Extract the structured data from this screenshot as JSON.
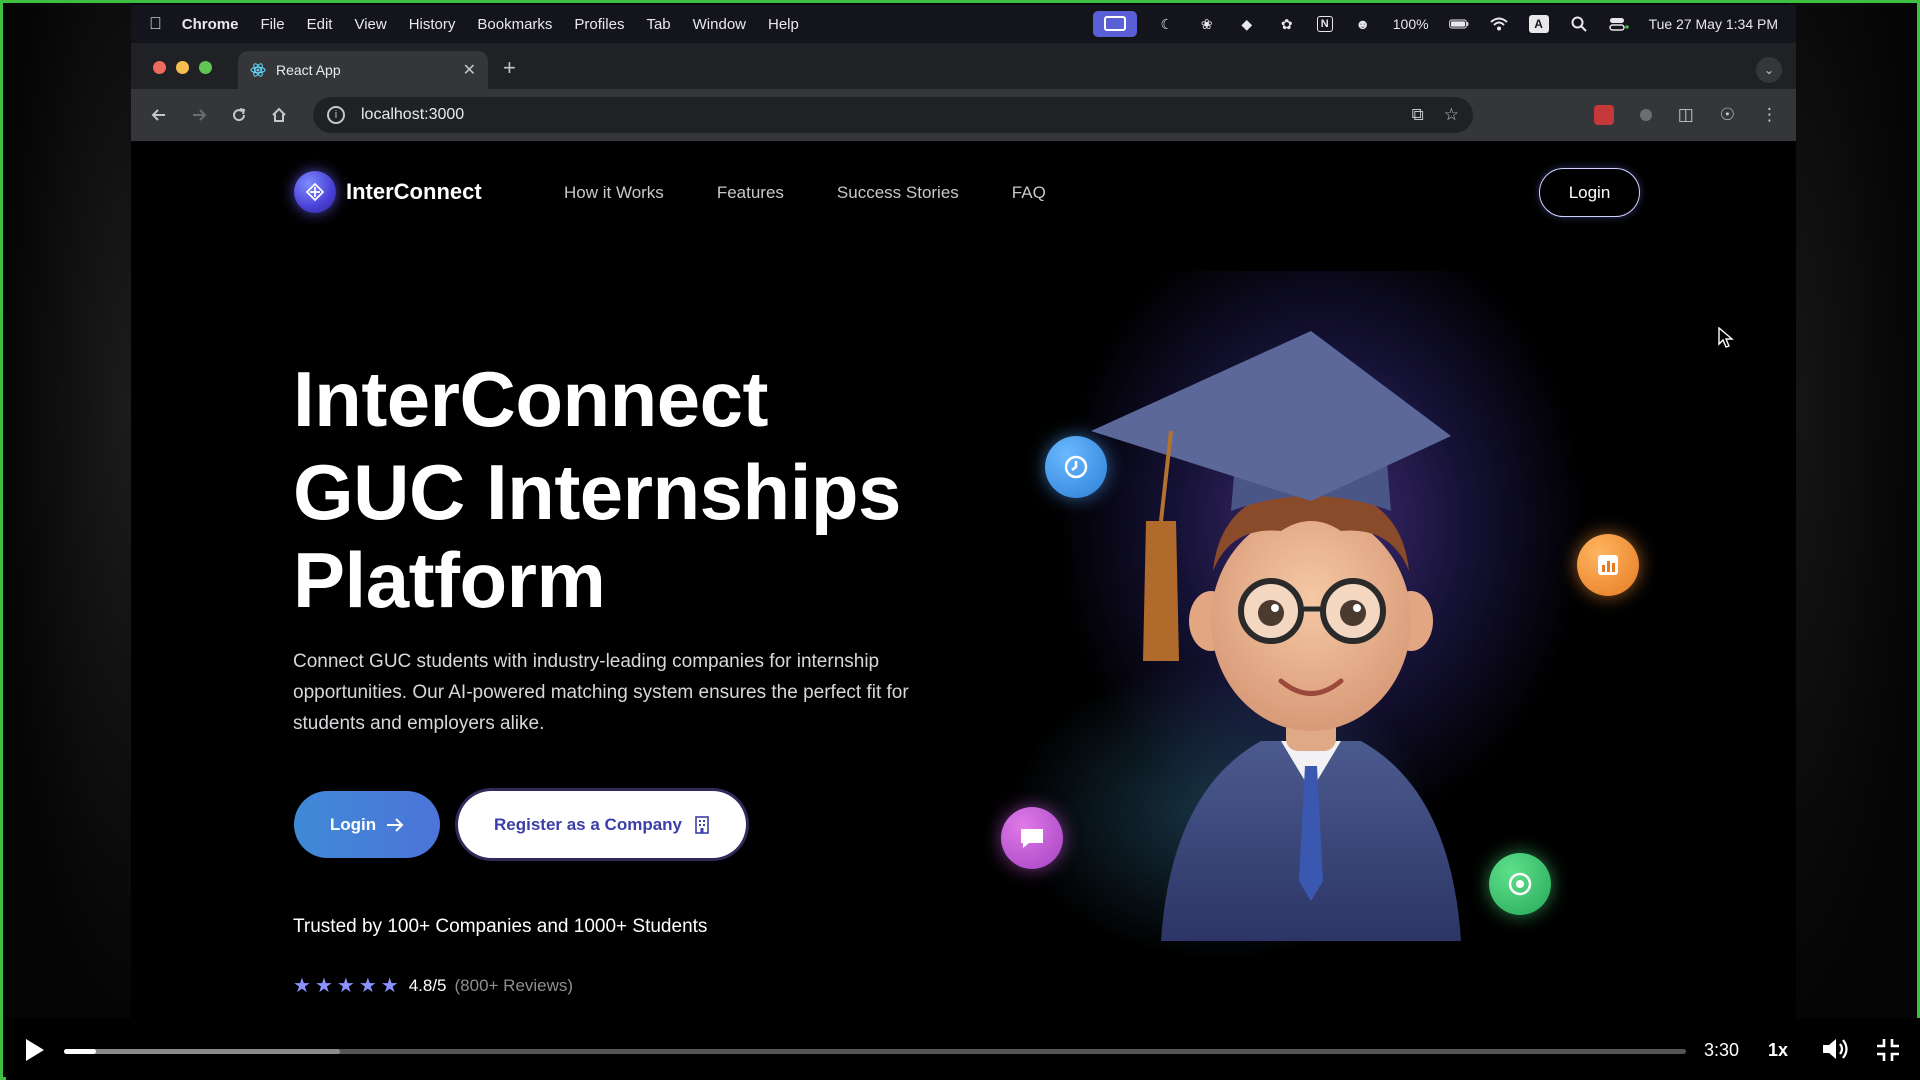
{
  "menubar": {
    "app": "Chrome",
    "items": [
      "File",
      "Edit",
      "View",
      "History",
      "Bookmarks",
      "Profiles",
      "Tab",
      "Window",
      "Help"
    ],
    "battery": "100%",
    "datetime": "Tue 27 May  1:34 PM"
  },
  "browser": {
    "tab_title": "React App",
    "url": "localhost:3000"
  },
  "site": {
    "brand": "InterConnect",
    "nav": [
      "How it Works",
      "Features",
      "Success Stories",
      "FAQ"
    ],
    "nav_login": "Login"
  },
  "hero": {
    "title_line1": "InterConnect",
    "title_line2": "GUC Internships",
    "title_line3": "Platform",
    "description": "Connect GUC students with industry-leading companies for internship opportunities. Our AI-powered matching system ensures the perfect fit for students and employers alike.",
    "login_button": "Login",
    "register_button": "Register as a Company",
    "trusted": "Trusted by 100+ Companies and 1000+ Students",
    "rating_stars": 5,
    "rating_value": "4.8/5",
    "rating_reviews": "(800+ Reviews)"
  },
  "player": {
    "time": "3:30",
    "speed": "1x",
    "progress": 0.02,
    "buffered": 0.17
  },
  "colors": {
    "accent": "#4c74d9",
    "brand_purple": "#4a3fd6",
    "frame_border": "#3fbf3f"
  },
  "icons": {
    "floating": [
      "clock-icon",
      "chart-icon",
      "chat-icon",
      "target-icon"
    ]
  }
}
